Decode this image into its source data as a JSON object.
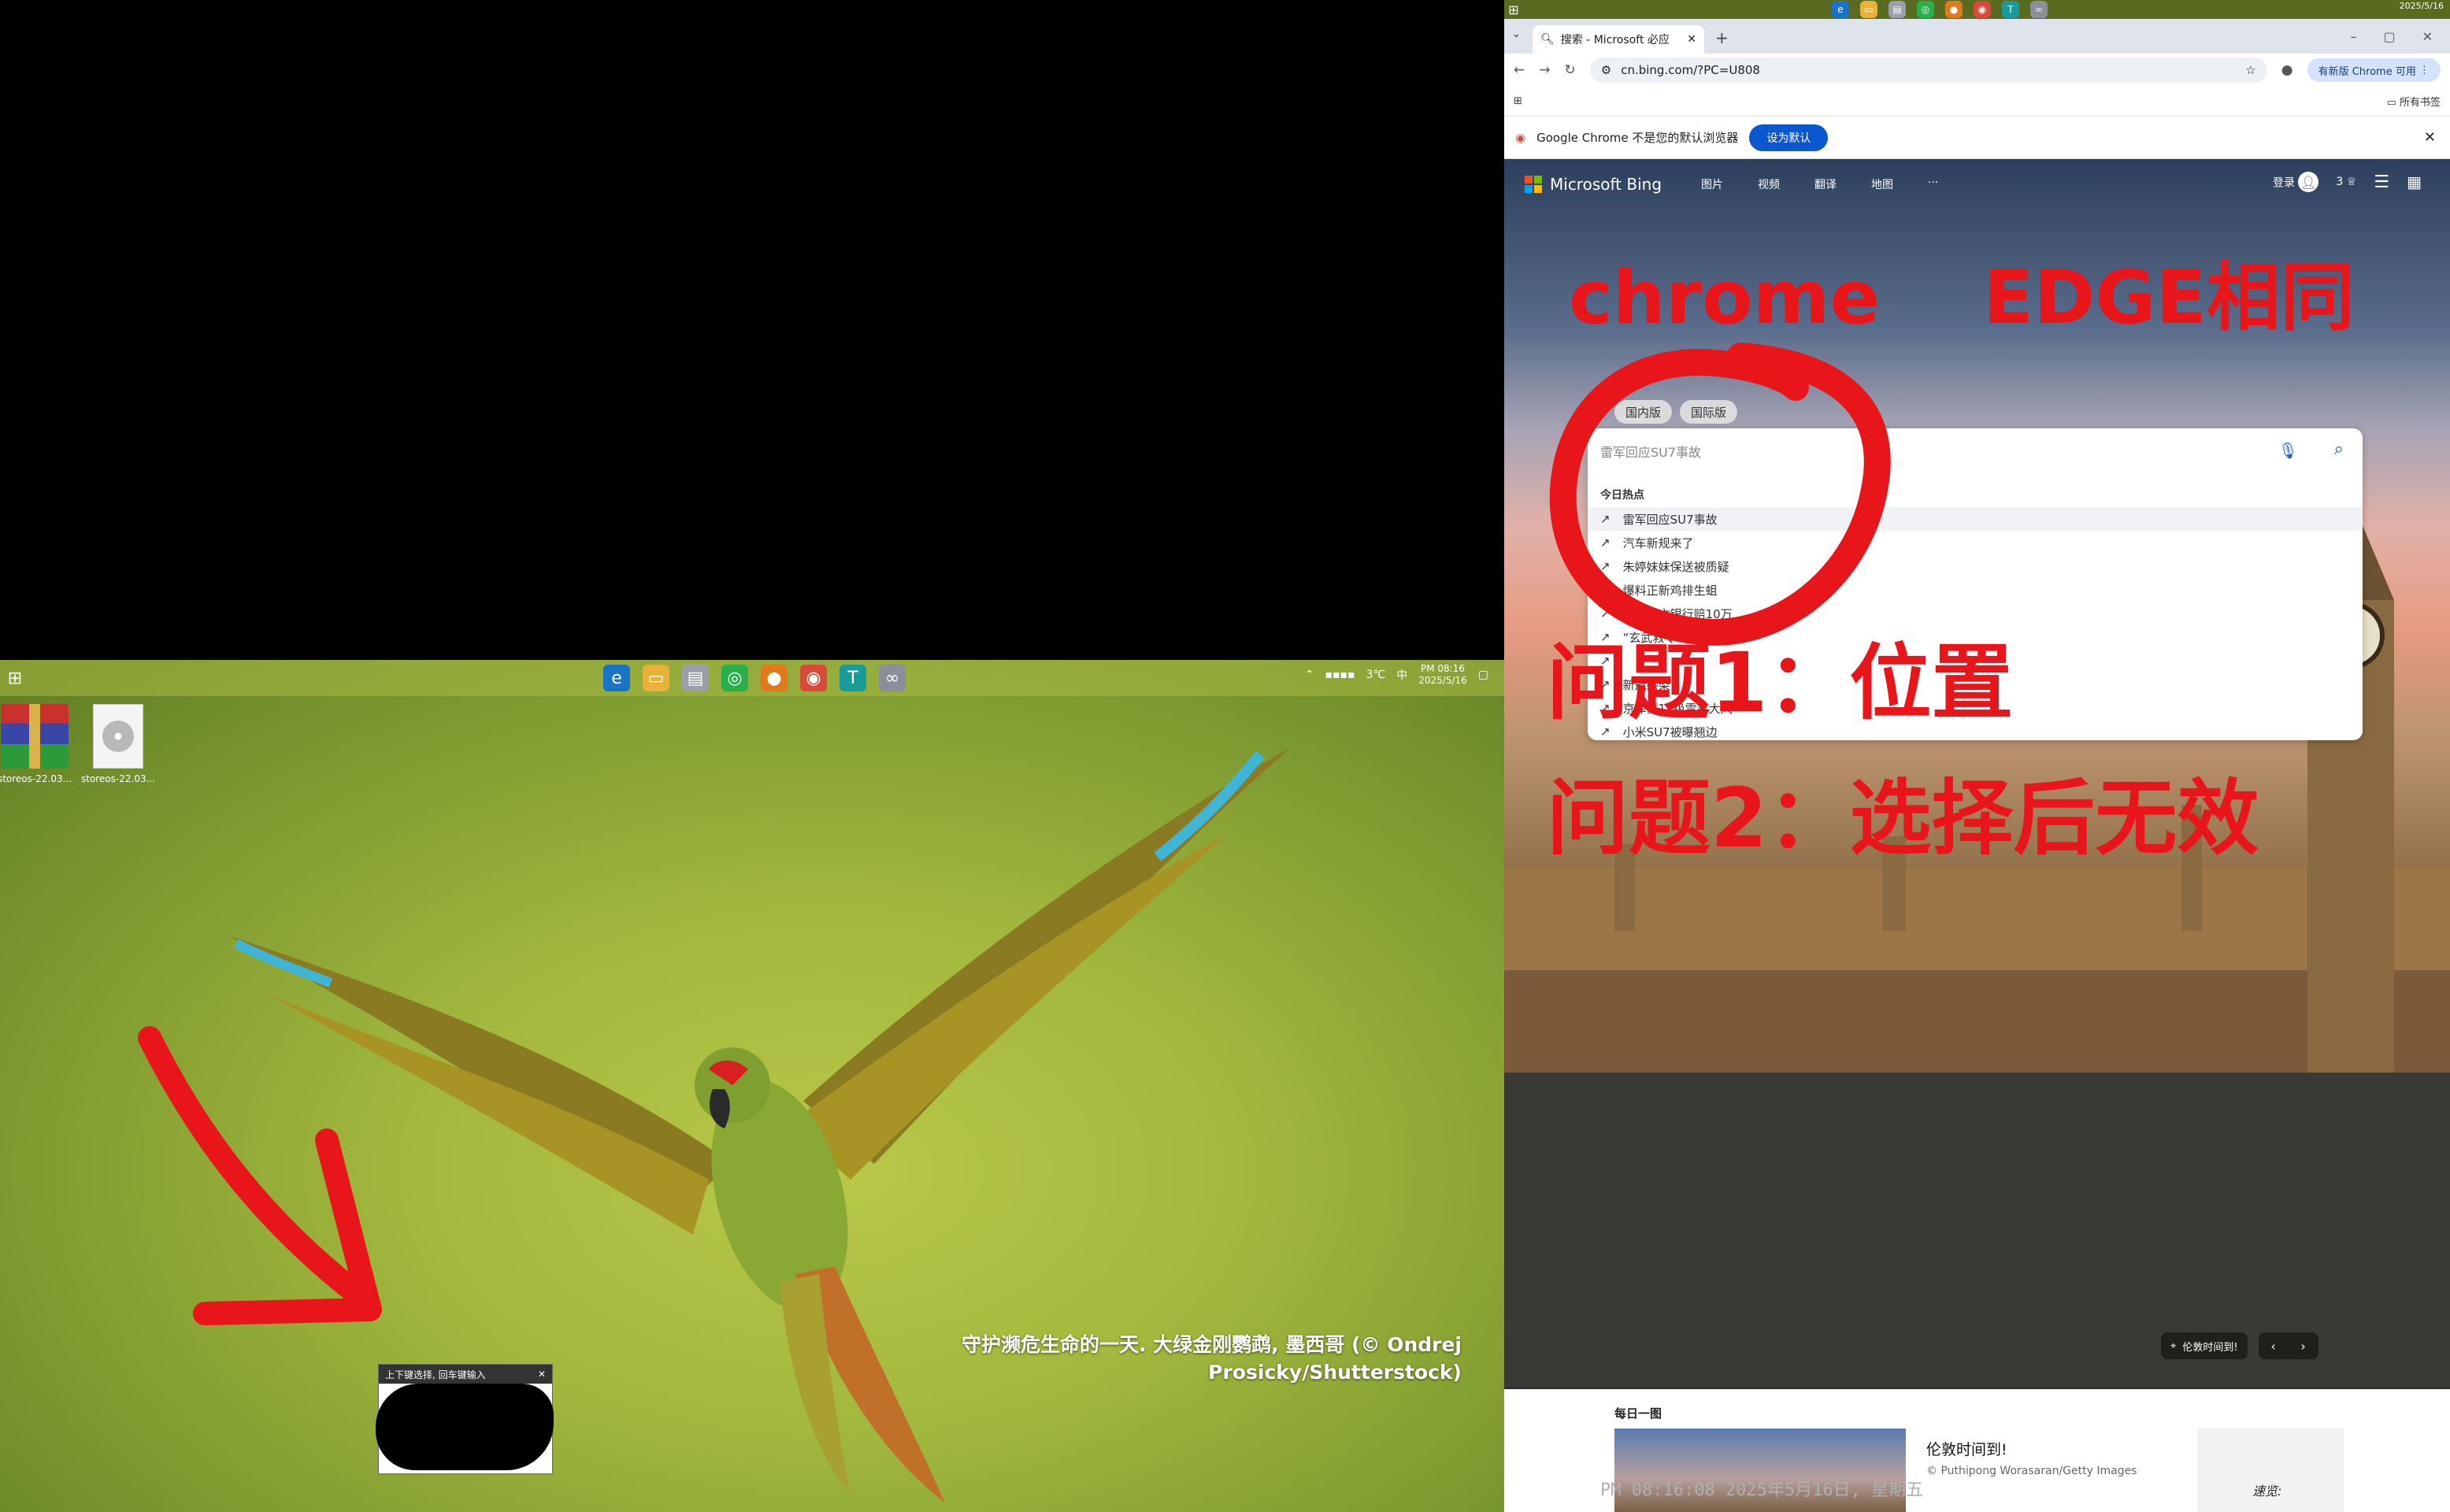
{
  "desktop": {
    "taskbar": {
      "start_icon": "windows-start-icon",
      "time": "PM 08:16",
      "date": "2025/5/16",
      "ime": "中",
      "temperature": "3℃"
    },
    "files": [
      {
        "name": "storeos-22.03..."
      },
      {
        "name": "storeos-22.03..."
      }
    ],
    "wallpaper_caption_line1": "守护濒危生命的一天. 大绿金刚鹦鹉, 墨西哥 (© Ondrej",
    "wallpaper_caption_line2": "Prosicky/Shutterstock)",
    "ime_popup_title": "上下键选择, 回车键输入"
  },
  "browser": {
    "top_date": "2025/5/16",
    "tab_title": "搜索 - Microsoft 必应",
    "url": "cn.bing.com/?PC=U808",
    "update_button": "有新版 Chrome 可用",
    "bookmarks_all": "所有书签",
    "infobar_text": "Google Chrome 不是您的默认浏览器",
    "infobar_button": "设为默认",
    "bing": {
      "logo_text": "Microsoft Bing",
      "nav": [
        "图片",
        "视频",
        "翻译",
        "地图",
        "···"
      ],
      "login": "登录",
      "rewards_count": "3",
      "version_tabs": [
        "国内版",
        "国际版"
      ],
      "search_placeholder": "雷军回应SU7事故",
      "suggestions_heading": "今日热点",
      "suggestions": [
        "雷军回应SU7事故",
        "汽车新规来了",
        "朱婷妹妹保送被质疑",
        "爆料正新鸡排生蛆",
        "取款身亡银行赔10万",
        "“玄武救令”改名",
        "",
        "新冠感染",
        "京津冀11级雷暴大风",
        "小米SU7被曝翘边"
      ],
      "location_label": "伦敦时间到!",
      "day_heading": "每日一图",
      "day_title": "伦敦时间到!",
      "day_credit": "© Puthipong Worasaran/Getty Images",
      "clock_overlay": "PM 08:16:08 2025年5月16日, 星期五",
      "side_label": "速览:"
    }
  },
  "annotations": {
    "title": "chrome    EDGE相同",
    "issue1": "问题1：位置",
    "issue2": "问题2：选择后无效"
  }
}
